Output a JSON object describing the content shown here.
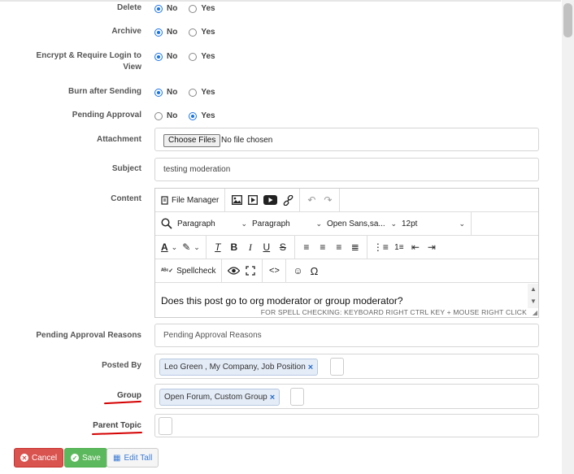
{
  "form": {
    "delete": {
      "label": "Delete",
      "options": [
        "No",
        "Yes"
      ],
      "selected": "No"
    },
    "archive": {
      "label": "Archive",
      "options": [
        "No",
        "Yes"
      ],
      "selected": "No"
    },
    "encrypt": {
      "label": "Encrypt & Require Login to View",
      "options": [
        "No",
        "Yes"
      ],
      "selected": "No"
    },
    "burn": {
      "label": "Burn after Sending",
      "options": [
        "No",
        "Yes"
      ],
      "selected": "No"
    },
    "pending": {
      "label": "Pending Approval",
      "options": [
        "No",
        "Yes"
      ],
      "selected": "Yes"
    },
    "attachment": {
      "label": "Attachment",
      "button": "Choose Files",
      "status": "No file chosen"
    },
    "subject": {
      "label": "Subject",
      "value": "testing moderation"
    },
    "content": {
      "label": "Content",
      "file_manager": "File Manager",
      "format_select": "Paragraph",
      "format_select2": "Paragraph",
      "font_select": "Open Sans,sa...",
      "size_select": "12pt",
      "spellcheck": "Spellcheck",
      "body_text": "Does this post go to org moderator or group moderator?",
      "spell_note": "FOR SPELL CHECKING: KEYBOARD RIGHT CTRL KEY + MOUSE RIGHT CLICK"
    },
    "reasons": {
      "label": "Pending Approval Reasons",
      "placeholder": "Pending Approval Reasons"
    },
    "posted_by": {
      "label": "Posted By",
      "tag": "Leo Green , My Company, Job Position"
    },
    "group": {
      "label": "Group",
      "tag": "Open Forum, Custom Group"
    },
    "parent_topic": {
      "label": "Parent Topic"
    }
  },
  "actions": {
    "cancel": "Cancel",
    "save": "Save",
    "edit_tall": "Edit Tall"
  },
  "colors": {
    "radio_selected": "#1a73e8",
    "cancel": "#d9534f",
    "save": "#5cb85c",
    "annotation": "#d40000"
  }
}
